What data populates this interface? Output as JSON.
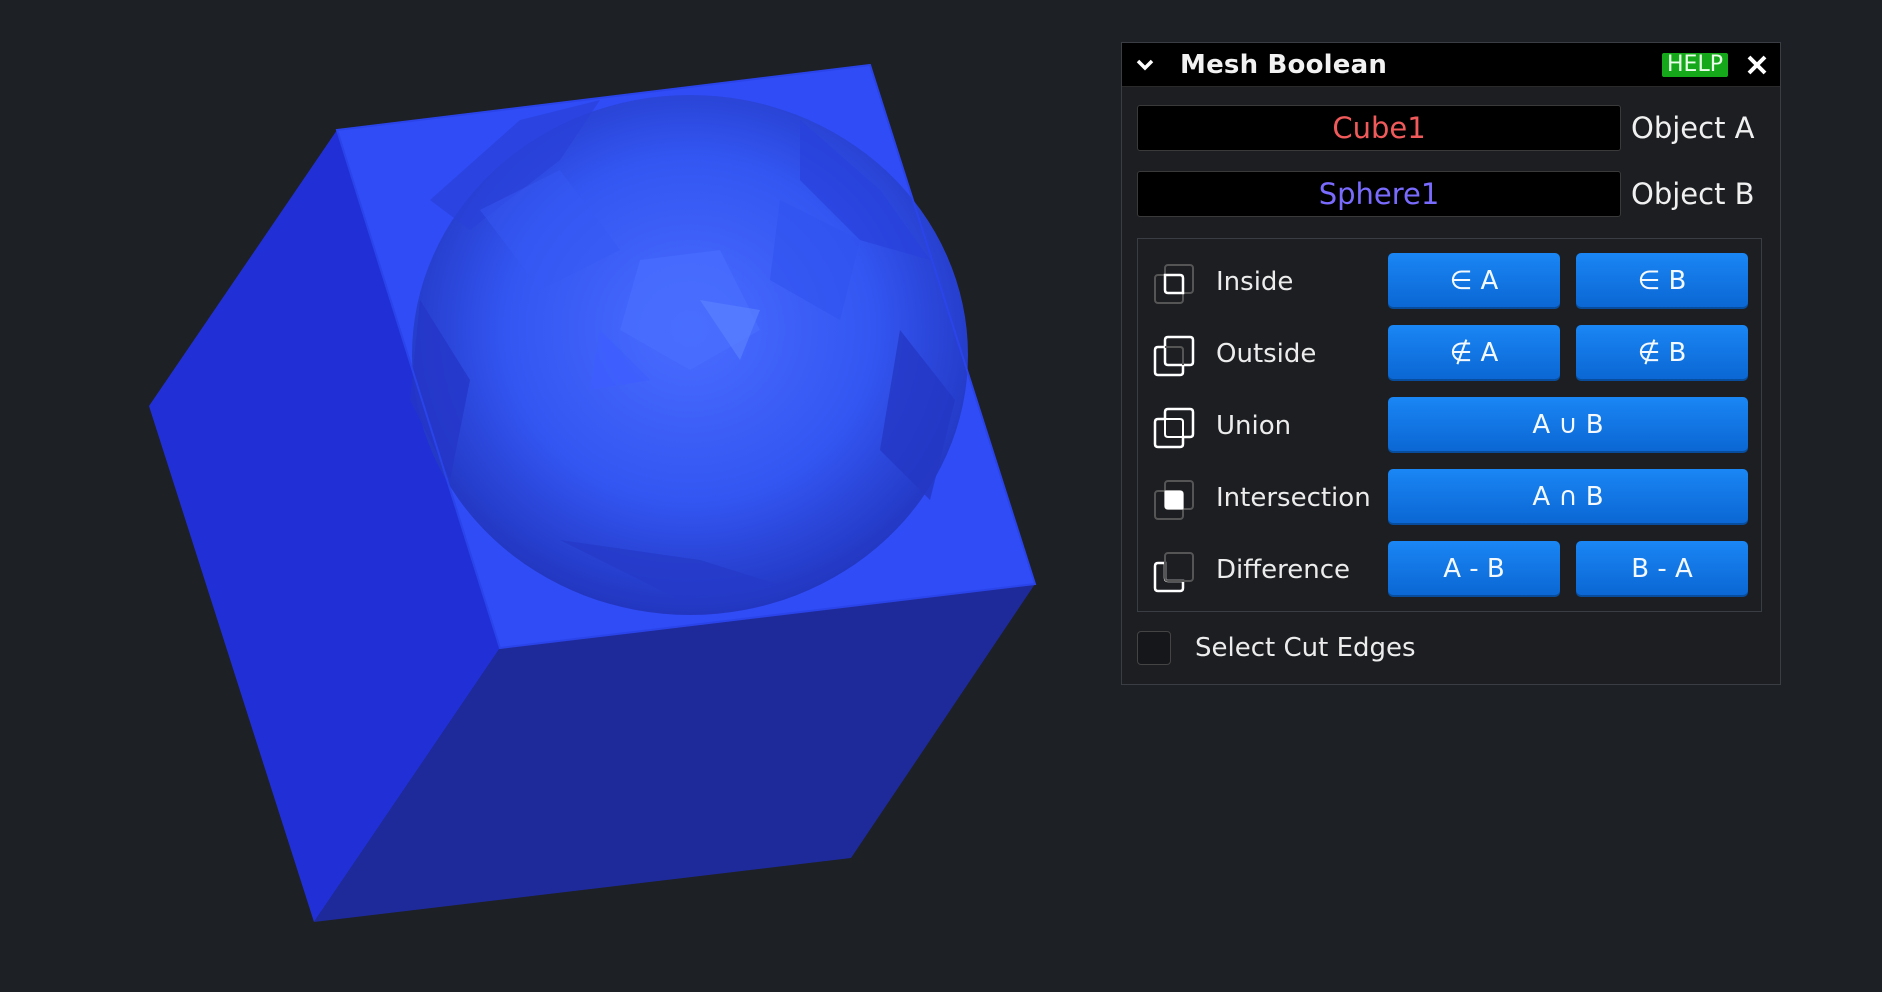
{
  "viewport": {
    "background": "#1d2024",
    "scene": "cube-minus-sphere",
    "cube_color": "#2b48f0"
  },
  "panel": {
    "title": "Mesh Boolean",
    "help_label": "HELP",
    "collapse_icon": "chevron-down-icon",
    "close_icon": "close-icon",
    "object_a": {
      "value": "Cube1",
      "label": "Object A",
      "color": "#f05a5a"
    },
    "object_b": {
      "value": "Sphere1",
      "label": "Object B",
      "color": "#7a6bff"
    },
    "operations": [
      {
        "label": "Inside",
        "icon": "inside-icon",
        "buttons": [
          "∈ A",
          "∈ B"
        ]
      },
      {
        "label": "Outside",
        "icon": "outside-icon",
        "buttons": [
          "∉ A",
          "∉ B"
        ]
      },
      {
        "label": "Union",
        "icon": "union-icon",
        "buttons": [
          "A ∪ B"
        ]
      },
      {
        "label": "Intersection",
        "icon": "intersection-icon",
        "buttons": [
          "A ∩ B"
        ]
      },
      {
        "label": "Difference",
        "icon": "difference-icon",
        "buttons": [
          "A - B",
          "B - A"
        ]
      }
    ],
    "select_cut_edges": {
      "label": "Select Cut Edges",
      "checked": false
    },
    "colors": {
      "button": "#0f74e6",
      "help": "#15a81a",
      "title_bg": "#000000"
    }
  }
}
